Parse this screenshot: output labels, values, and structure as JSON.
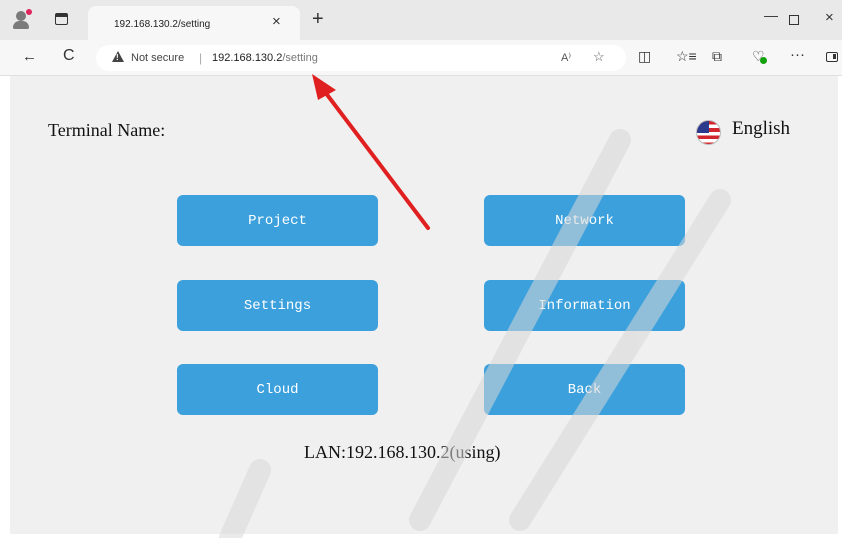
{
  "browser": {
    "tab_title": "192.168.130.2/setting",
    "tab_close": "×",
    "new_tab": "+",
    "window": {
      "minimize": "—",
      "close": "×"
    },
    "nav": {
      "back": "←",
      "refresh": "C"
    },
    "address": {
      "security_label": "Not secure",
      "separator": "|",
      "host": "192.168.130.2",
      "path": "/setting"
    },
    "icons": {
      "read_aloud": "A⁾",
      "favorite": "☆",
      "split": "◫",
      "favorites": "☆≡",
      "collections": "⧉",
      "health": "♡",
      "more": "···"
    }
  },
  "page": {
    "terminal_name_label": "Terminal Name:",
    "language": "English",
    "buttons": {
      "project": "Project",
      "network": "Network",
      "settings": "Settings",
      "information": "Information",
      "cloud": "Cloud",
      "back": "Back"
    },
    "lan_status": "LAN:192.168.130.2(using)"
  },
  "colors": {
    "button_bg": "#3ba0dc",
    "button_text": "#ffffff",
    "page_bg": "#f0f0f0",
    "annotation_arrow": "#e02020"
  }
}
